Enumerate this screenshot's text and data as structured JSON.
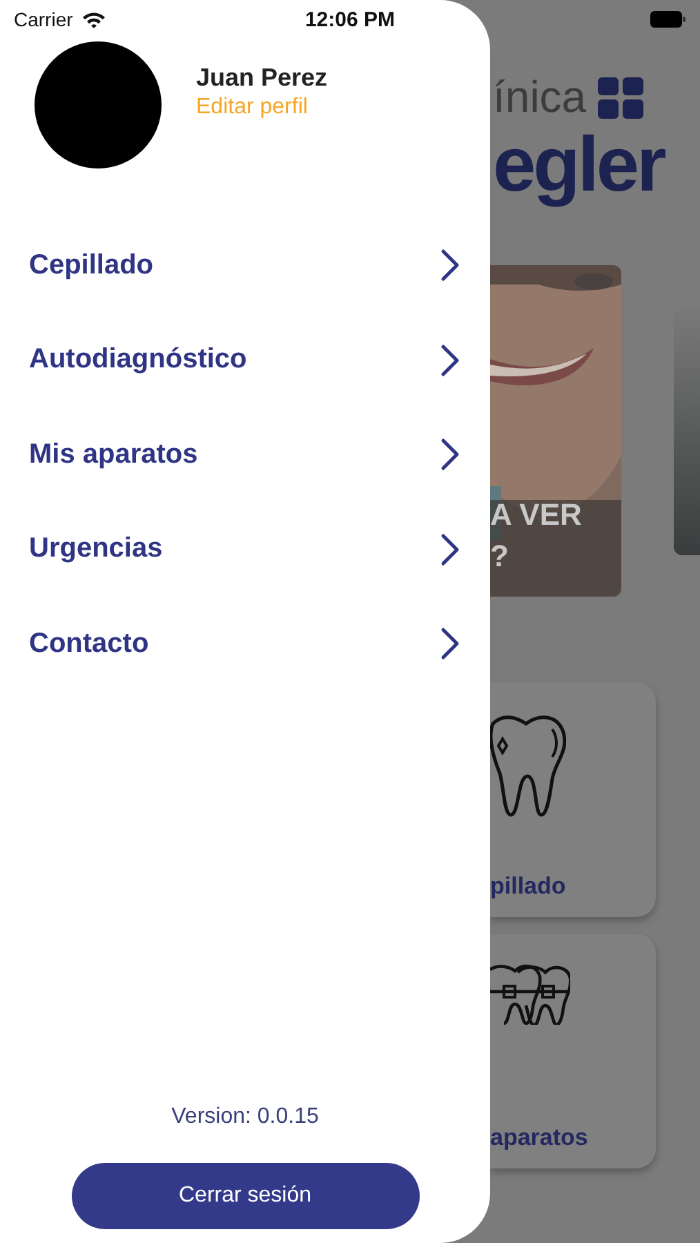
{
  "status_bar": {
    "carrier": "Carrier",
    "time": "12:06 PM"
  },
  "drawer": {
    "profile": {
      "name": "Juan Perez",
      "edit_link": "Editar perfil"
    },
    "menu": [
      {
        "label": "Cepillado"
      },
      {
        "label": "Autodiagnóstico"
      },
      {
        "label": "Mis aparatos"
      },
      {
        "label": "Urgencias"
      },
      {
        "label": "Contacto"
      }
    ],
    "version": "Version: 0.0.15",
    "logout_button": "Cerrar sesión"
  },
  "background": {
    "logo": {
      "line_1": "ínica",
      "line_2": "egler"
    },
    "promo": {
      "kind": "picture",
      "line_1": "A VER",
      "line_2": "?"
    },
    "cards": [
      {
        "kind": "tooth",
        "label": "pillado"
      },
      {
        "kind": "braces",
        "label": "aparatos"
      }
    ]
  }
}
